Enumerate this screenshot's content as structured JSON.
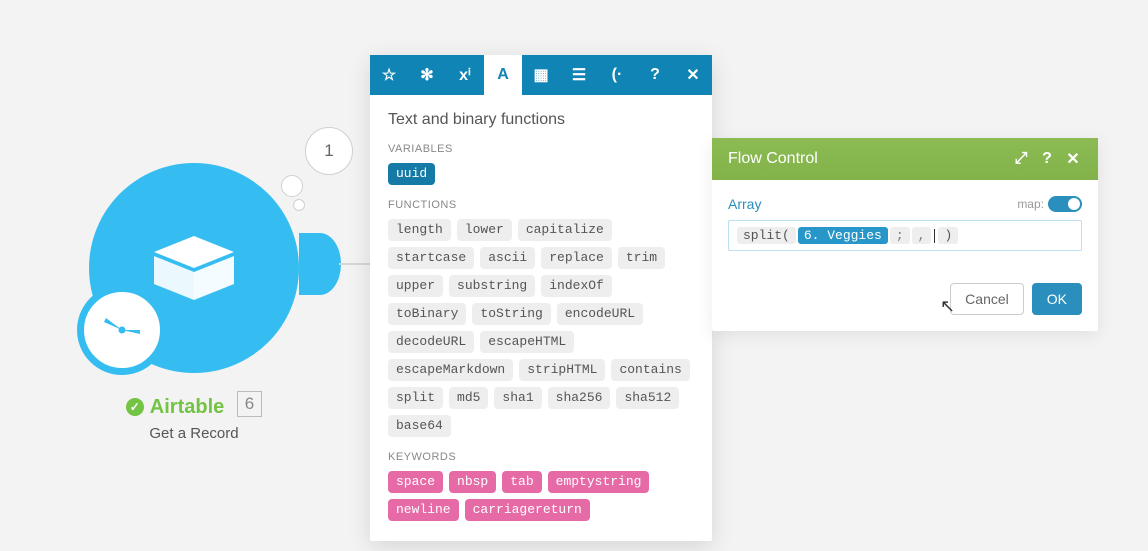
{
  "module": {
    "bubble_number": "1",
    "label": "Airtable",
    "count": "6",
    "sublabel": "Get a Record"
  },
  "functions_panel": {
    "title": "Text and binary functions",
    "sections": {
      "variables_label": "VARIABLES",
      "functions_label": "FUNCTIONS",
      "keywords_label": "KEYWORDS"
    },
    "variables": [
      "uuid"
    ],
    "functions": [
      "length",
      "lower",
      "capitalize",
      "startcase",
      "ascii",
      "replace",
      "trim",
      "upper",
      "substring",
      "indexOf",
      "toBinary",
      "toString",
      "encodeURL",
      "decodeURL",
      "escapeHTML",
      "escapeMarkdown",
      "stripHTML",
      "contains",
      "split",
      "md5",
      "sha1",
      "sha256",
      "sha512",
      "base64"
    ],
    "keywords": [
      "space",
      "nbsp",
      "tab",
      "emptystring",
      "newline",
      "carriagereturn"
    ]
  },
  "flow_panel": {
    "title": "Flow Control",
    "field_label": "Array",
    "map_label": "map:",
    "expression": {
      "fn_open": "split(",
      "arg": "6. Veggies",
      "sep1": ";",
      "sep2": ",",
      "close": ")"
    },
    "buttons": {
      "cancel": "Cancel",
      "ok": "OK"
    }
  },
  "tab_glyphs": {
    "star": "☆",
    "gear": "✻",
    "math": "xⁱ",
    "text": "A",
    "calendar": "▦",
    "list": "☰",
    "misc": "(·",
    "help": "?",
    "close": "✕"
  }
}
